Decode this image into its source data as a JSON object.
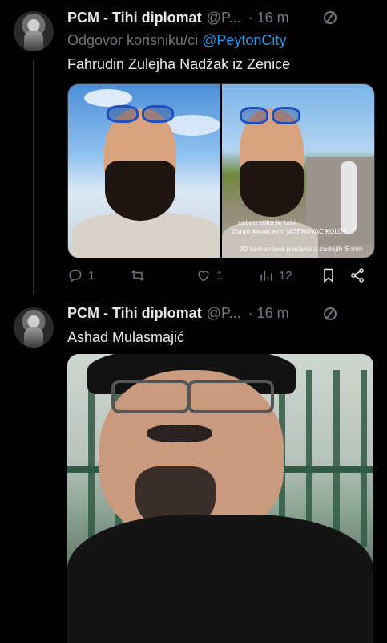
{
  "tweets": [
    {
      "display_name": "PCM - Tihi diplomat",
      "handle": "@P...",
      "time": "16 m",
      "reply_to_prefix": "Odgovor korisniku/ci",
      "reply_to_user": "@PeytonCity",
      "text": "Fahrudin Zulejha Nadžak iz Zenice",
      "media_overlay": {
        "line1": "saban slika je tebi",
        "line2": "Zoran Kovacevic JASENOVAC KOLOC",
        "line3": "30 komentara poslano u zadnjih 5 min"
      },
      "actions": {
        "replies": "1",
        "reposts": "",
        "likes": "1",
        "views": "12"
      }
    },
    {
      "display_name": "PCM - Tihi diplomat",
      "handle": "@P...",
      "time": "16 m",
      "text": "Ashad Mulasmajić"
    }
  ],
  "icons": {
    "more": "circle-slash-icon",
    "reply": "reply-icon",
    "repost": "repost-icon",
    "like": "heart-icon",
    "views": "views-icon",
    "bookmark": "bookmark-icon",
    "share": "share-icon"
  },
  "colors": {
    "background": "#000000",
    "text": "#e7e9ea",
    "muted": "#71767b",
    "link": "#1d9bf0"
  }
}
